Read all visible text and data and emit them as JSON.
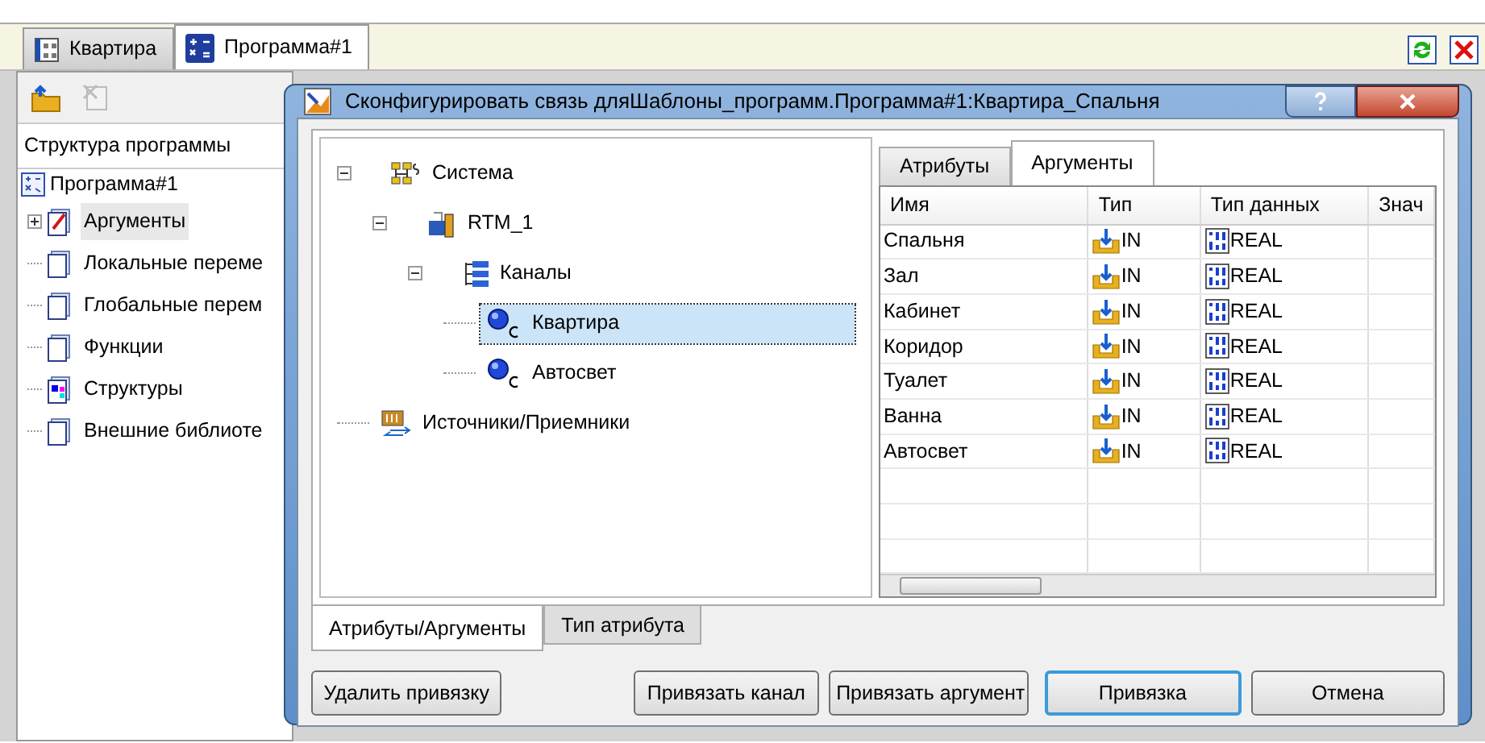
{
  "tabs": [
    {
      "label": "Квартира",
      "kind": "table",
      "selected": false
    },
    {
      "label": "Программа#1",
      "kind": "program",
      "selected": true
    }
  ],
  "program_panel": {
    "header": "Структура программы",
    "root": {
      "label": "Программа#1",
      "children": [
        {
          "label": "Аргументы",
          "kind": "arguments",
          "selected": true,
          "expanded": false
        },
        {
          "label": "Локальные переме",
          "kind": "page",
          "selected": false
        },
        {
          "label": "Глобальные перем",
          "kind": "page",
          "selected": false
        },
        {
          "label": "Функции",
          "kind": "page",
          "selected": false
        },
        {
          "label": "Структуры",
          "kind": "structs",
          "selected": false
        },
        {
          "label": "Внешние библиоте",
          "kind": "page",
          "selected": false
        }
      ]
    }
  },
  "dialog": {
    "title": "Сконфигурировать связь дляШаблоны_программ.Программа#1:Квартира_Спальня",
    "tree": [
      {
        "label": "Система",
        "kind": "system",
        "selected": false,
        "expanded": true,
        "children": [
          {
            "label": "RTM_1",
            "kind": "rtm",
            "selected": false,
            "expanded": true,
            "children": [
              {
                "label": "Каналы",
                "kind": "channels",
                "selected": false,
                "expanded": true,
                "children": [
                  {
                    "label": "Квартира",
                    "kind": "channel",
                    "selected": true
                  },
                  {
                    "label": "Автосвет",
                    "kind": "channel",
                    "selected": false
                  }
                ]
              }
            ]
          }
        ]
      },
      {
        "label": "Источники/Приемники",
        "kind": "sources",
        "selected": false
      }
    ],
    "tabs": [
      {
        "label": "Атрибуты",
        "selected": false
      },
      {
        "label": "Аргументы",
        "selected": true
      }
    ],
    "table": {
      "columns": [
        "Имя",
        "Тип",
        "Тип данных",
        "Знач"
      ],
      "rows": [
        {
          "name": "Спальня",
          "type": "IN",
          "data_type": "REAL"
        },
        {
          "name": "Зал",
          "type": "IN",
          "data_type": "REAL"
        },
        {
          "name": "Кабинет",
          "type": "IN",
          "data_type": "REAL"
        },
        {
          "name": "Коридор",
          "type": "IN",
          "data_type": "REAL"
        },
        {
          "name": "Туалет",
          "type": "IN",
          "data_type": "REAL"
        },
        {
          "name": "Ванна",
          "type": "IN",
          "data_type": "REAL"
        },
        {
          "name": "Автосвет",
          "type": "IN",
          "data_type": "REAL"
        }
      ]
    },
    "bottom_tabs": [
      {
        "label": "Атрибуты/Аргументы",
        "selected": true
      },
      {
        "label": "Тип атрибута",
        "selected": false
      }
    ],
    "buttons": [
      {
        "label": "Удалить привязку",
        "default": false
      },
      {
        "label": "Привязать канал",
        "default": false
      },
      {
        "label": "Привязать аргумент",
        "default": false
      },
      {
        "label": "Привязка",
        "default": true
      },
      {
        "label": "Отмена",
        "default": false
      }
    ]
  }
}
